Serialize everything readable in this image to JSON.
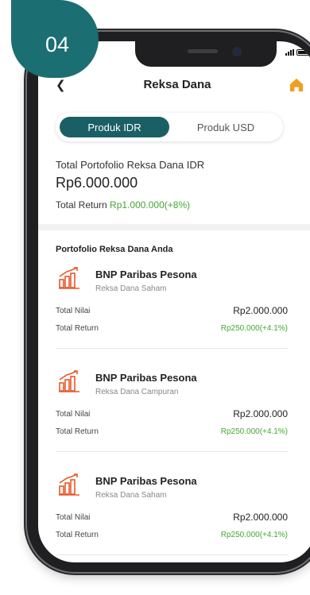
{
  "badge": {
    "label": "04"
  },
  "header": {
    "title": "Reksa Dana",
    "back_icon": "chevron-left-icon",
    "home_icon": "home-icon"
  },
  "colors": {
    "primary": "#1b5f66",
    "badge": "#1b6e72",
    "positive": "#43a832",
    "home_icon": "#f0a020",
    "fund_icon": "#e8582a"
  },
  "tabs": [
    {
      "label": "Produk IDR",
      "active": true
    },
    {
      "label": "Produk USD",
      "active": false
    }
  ],
  "summary": {
    "label": "Total Portofolio Reksa Dana IDR",
    "value": "Rp6.000.000",
    "return_label": "Total Return ",
    "return_value": "Rp1.000.000(+8%)"
  },
  "section_title": "Portofolio Reksa Dana Anda",
  "funds": [
    {
      "name": "BNP Paribas Pesona",
      "type": "Reksa Dana Saham",
      "nilai_label": "Total Nilai",
      "nilai": "Rp2.000.000",
      "return_label": "Total Return",
      "return": "Rp250.000(+4.1%)"
    },
    {
      "name": "BNP Paribas Pesona",
      "type": "Reksa Dana Campuran",
      "nilai_label": "Total Nilai",
      "nilai": "Rp2.000.000",
      "return_label": "Total Return",
      "return": "Rp250.000(+4.1%)"
    },
    {
      "name": "BNP Paribas Pesona",
      "type": "Reksa Dana Saham",
      "nilai_label": "Total Nilai",
      "nilai": "Rp2.000.000",
      "return_label": "Total Return",
      "return": "Rp250.000(+4.1%)"
    }
  ]
}
